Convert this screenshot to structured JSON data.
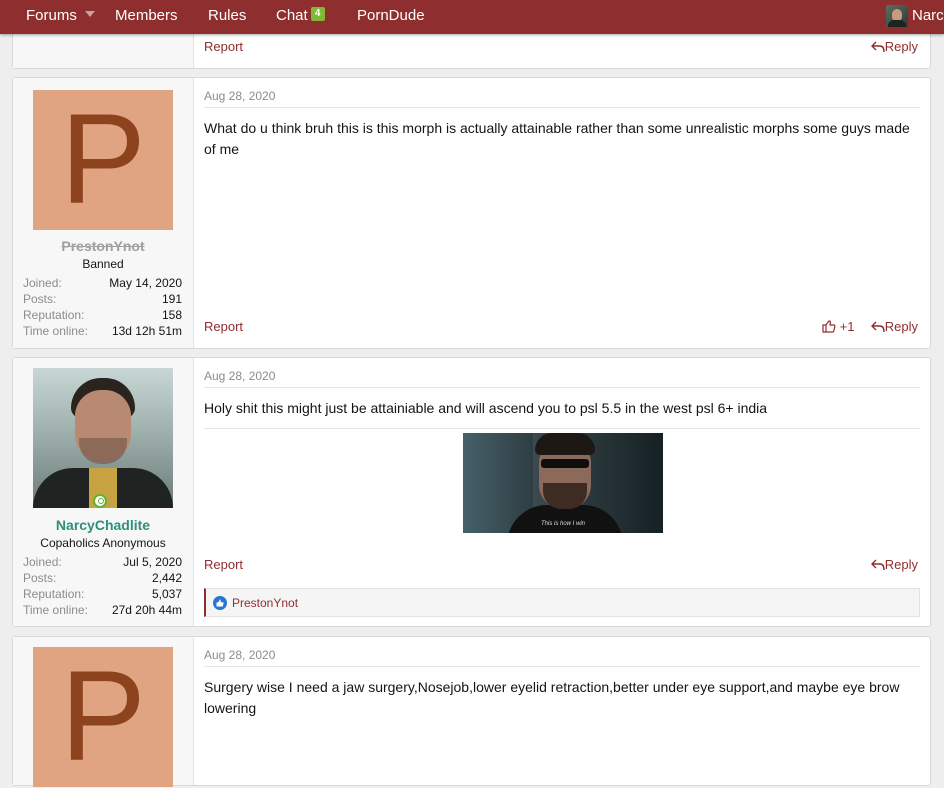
{
  "nav": {
    "items": [
      {
        "label": "Forums",
        "has_caret": true
      },
      {
        "label": "Members"
      },
      {
        "label": "Rules"
      },
      {
        "label": "Chat",
        "badge": "4"
      },
      {
        "label": "PornDude"
      }
    ],
    "username": "Narc"
  },
  "prev_post": {
    "report_label": "Report",
    "reply_label": "Reply"
  },
  "posts": [
    {
      "avatar_letter": "P",
      "username": "PrestonYnot",
      "user_title": "Banned",
      "stats": [
        {
          "label": "Joined:",
          "value": "May 14, 2020"
        },
        {
          "label": "Posts:",
          "value": "191"
        },
        {
          "label": "Reputation:",
          "value": "158"
        },
        {
          "label": "Time online:",
          "value": "13d 12h 51m"
        }
      ],
      "date": "Aug 28, 2020",
      "message": "What do u think bruh this is this morph is actually attainable rather than some unrealistic morphs some guys made of me",
      "report_label": "Report",
      "like_label": "+1",
      "reply_label": "Reply"
    },
    {
      "username": "NarcyChadlite",
      "user_title": "Copaholics Anonymous",
      "stats": [
        {
          "label": "Joined:",
          "value": "Jul 5, 2020"
        },
        {
          "label": "Posts:",
          "value": "2,442"
        },
        {
          "label": "Reputation:",
          "value": "5,037"
        },
        {
          "label": "Time online:",
          "value": "27d 20h 44m"
        }
      ],
      "date": "Aug 28, 2020",
      "message": "Holy shit this might just be attainiable and will ascend you to psl 5.5 in the west psl 6+ india",
      "media_caption": "This is how I win",
      "report_label": "Report",
      "reply_label": "Reply",
      "reaction_user": "PrestonYnot"
    },
    {
      "avatar_letter": "P",
      "date": "Aug 28, 2020",
      "message": "Surgery wise I need a jaw surgery,Nosejob,lower eyelid retraction,better under eye support,and maybe eye brow lowering"
    }
  ],
  "colors": {
    "nav_bg": "#8f2e2e",
    "link": "#8f2e2e",
    "avatar_bg": "#e0a483",
    "avatar_letter": "#8e431f",
    "username_active": "#2f8f7a",
    "chat_badge": "#7fb935",
    "online": "#63b32d",
    "like_reaction": "#2577d2"
  }
}
